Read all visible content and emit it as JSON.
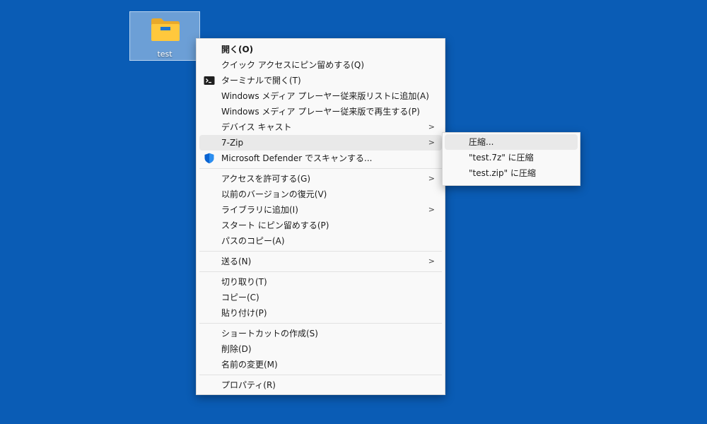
{
  "desktop": {
    "background_color": "#0a5cb5",
    "icon": {
      "label": "test",
      "icon": "folder-icon"
    }
  },
  "context_menu": {
    "groups": [
      [
        {
          "label": "開く(O)",
          "bold": true,
          "icon": "",
          "submenu": false
        },
        {
          "label": "クイック アクセスにピン留めする(Q)",
          "icon": "",
          "submenu": false
        },
        {
          "label": "ターミナルで開く(T)",
          "icon": "terminal-icon",
          "submenu": false
        },
        {
          "label": "Windows メディア プレーヤー従来版リストに追加(A)",
          "icon": "",
          "submenu": false
        },
        {
          "label": "Windows メディア プレーヤー従来版で再生する(P)",
          "icon": "",
          "submenu": false
        },
        {
          "label": "デバイス キャスト",
          "icon": "",
          "submenu": true
        },
        {
          "label": "7-Zip",
          "icon": "",
          "submenu": true,
          "highlighted": true
        },
        {
          "label": "Microsoft Defender でスキャンする...",
          "icon": "defender-shield-icon",
          "submenu": false
        }
      ],
      [
        {
          "label": "アクセスを許可する(G)",
          "icon": "",
          "submenu": true
        },
        {
          "label": "以前のバージョンの復元(V)",
          "icon": "",
          "submenu": false
        },
        {
          "label": "ライブラリに追加(I)",
          "icon": "",
          "submenu": true
        },
        {
          "label": "スタート にピン留めする(P)",
          "icon": "",
          "submenu": false
        },
        {
          "label": "パスのコピー(A)",
          "icon": "",
          "submenu": false
        }
      ],
      [
        {
          "label": "送る(N)",
          "icon": "",
          "submenu": true
        }
      ],
      [
        {
          "label": "切り取り(T)",
          "icon": "",
          "submenu": false
        },
        {
          "label": "コピー(C)",
          "icon": "",
          "submenu": false
        },
        {
          "label": "貼り付け(P)",
          "icon": "",
          "submenu": false
        }
      ],
      [
        {
          "label": "ショートカットの作成(S)",
          "icon": "",
          "submenu": false
        },
        {
          "label": "削除(D)",
          "icon": "",
          "submenu": false
        },
        {
          "label": "名前の変更(M)",
          "icon": "",
          "submenu": false
        }
      ],
      [
        {
          "label": "プロパティ(R)",
          "icon": "",
          "submenu": false
        }
      ]
    ]
  },
  "zip_submenu": {
    "items": [
      {
        "label": "圧縮...",
        "highlighted": true
      },
      {
        "label": "\"test.7z\" に圧縮"
      },
      {
        "label": "\"test.zip\" に圧縮"
      }
    ]
  },
  "submenu_arrow": ">"
}
